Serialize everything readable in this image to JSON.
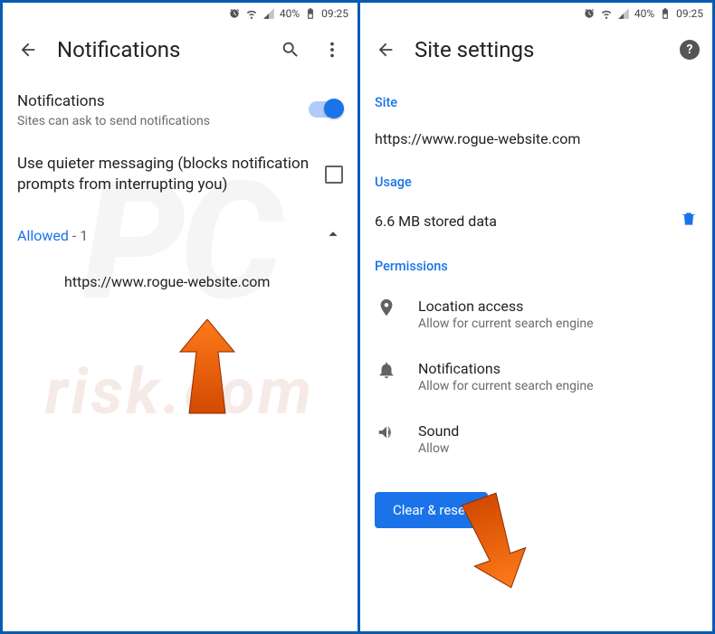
{
  "status_bar": {
    "battery_pct": "40%",
    "time": "09:25"
  },
  "left": {
    "title": "Notifications",
    "notif_title": "Notifications",
    "notif_sub": "Sites can ask to send notifications",
    "quiet_title": "Use quieter messaging (blocks notification prompts from interrupting you)",
    "allowed_label": "Allowed",
    "allowed_count": "- 1",
    "site_url": "https://www.rogue-website.com"
  },
  "right": {
    "title": "Site settings",
    "section_site": "Site",
    "site_url": "https://www.rogue-website.com",
    "section_usage": "Usage",
    "usage_text": "6.6 MB stored data",
    "section_permissions": "Permissions",
    "perm_location_title": "Location access",
    "perm_location_sub": "Allow for current search engine",
    "perm_notif_title": "Notifications",
    "perm_notif_sub": "Allow for current search engine",
    "perm_sound_title": "Sound",
    "perm_sound_sub": "Allow",
    "clear_button": "Clear & reset"
  }
}
